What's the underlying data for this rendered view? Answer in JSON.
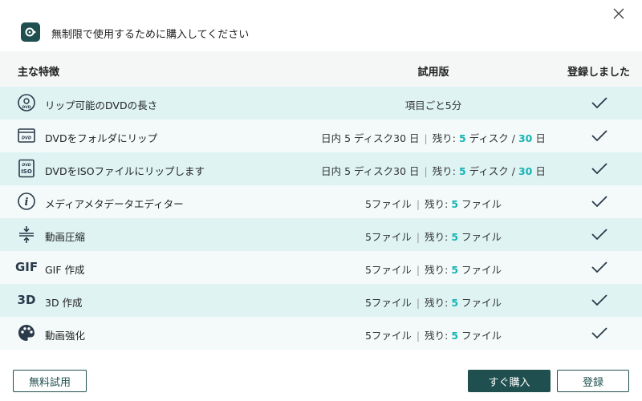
{
  "header": {
    "title": "無制限で使用するために購入してください",
    "icon": "app-logo-icon",
    "close_icon": "close-icon"
  },
  "table": {
    "col_feature": "主な特徴",
    "col_trial": "試用版",
    "col_registered": "登録しました"
  },
  "rows": [
    {
      "icon": "disc-rip-icon",
      "label": "リップ可能のDVDの長さ",
      "trial": {
        "plain": "項目ごと5分"
      }
    },
    {
      "icon": "dvd-folder-icon",
      "label": "DVDをフォルダにリップ",
      "trial": {
        "prefix": "日内 5 ディスク30 日",
        "remain_label": "残り:",
        "remain_value": "5",
        "unit1": "ディスク",
        "slash": "/",
        "days_value": "30",
        "unit2": "日"
      }
    },
    {
      "icon": "dvd-iso-icon",
      "label": "DVDをISOファイルにリップします",
      "trial": {
        "prefix": "日内 5 ディスク30 日",
        "remain_label": "残り:",
        "remain_value": "5",
        "unit1": "ディスク",
        "slash": "/",
        "days_value": "30",
        "unit2": "日"
      }
    },
    {
      "icon": "info-icon",
      "label": "メディアメタデータエディター",
      "trial": {
        "prefix": "5ファイル",
        "remain_label": "残り:",
        "remain_value": "5",
        "unit1": "ファイル"
      }
    },
    {
      "icon": "compress-icon",
      "label": "動画圧縮",
      "trial": {
        "prefix": "5ファイル",
        "remain_label": "残り:",
        "remain_value": "5",
        "unit1": "ファイル"
      }
    },
    {
      "icon": "gif-icon",
      "icon_text": "GIF",
      "label": "GIF 作成",
      "trial": {
        "prefix": "5ファイル",
        "remain_label": "残り:",
        "remain_value": "5",
        "unit1": "ファイル"
      }
    },
    {
      "icon": "3d-icon",
      "icon_text": "3D",
      "label": "3D 作成",
      "trial": {
        "prefix": "5ファイル",
        "remain_label": "残り:",
        "remain_value": "5",
        "unit1": "ファイル"
      }
    },
    {
      "icon": "palette-icon",
      "label": "動画強化",
      "trial": {
        "prefix": "5ファイル",
        "remain_label": "残り:",
        "remain_value": "5",
        "unit1": "ファイル"
      }
    }
  ],
  "footer": {
    "free_trial": "無料試用",
    "buy_now": "すぐ購入",
    "register": "登録"
  },
  "colors": {
    "accent": "#16b4b4",
    "primary": "#1f4f4f",
    "row_odd": "#dff3f3",
    "row_even": "#f4fafa"
  }
}
